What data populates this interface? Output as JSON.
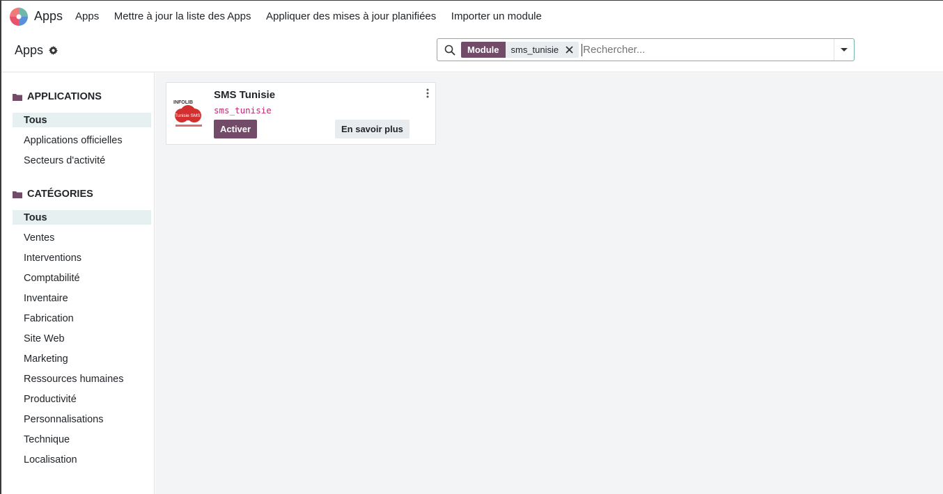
{
  "navbar": {
    "brand": "Apps",
    "menu": [
      "Apps",
      "Mettre à jour la liste des Apps",
      "Appliquer des mises à jour planifiées",
      "Importer un module"
    ]
  },
  "control_panel": {
    "breadcrumb": "Apps",
    "search": {
      "facet_label": "Module",
      "facet_value": "sms_tunisie",
      "placeholder": "Rechercher..."
    }
  },
  "sidebar": {
    "applications_header": "APPLICATIONS",
    "applications": [
      "Tous",
      "Applications officielles",
      "Secteurs d'activité"
    ],
    "categories_header": "CATÉGORIES",
    "categories": [
      "Tous",
      "Ventes",
      "Interventions",
      "Comptabilité",
      "Inventaire",
      "Fabrication",
      "Site Web",
      "Marketing",
      "Ressources humaines",
      "Productivité",
      "Personnalisations",
      "Technique",
      "Localisation"
    ]
  },
  "module_card": {
    "title": "SMS Tunisie",
    "technical_name": "sms_tunisie",
    "activate_label": "Activer",
    "learn_more_label": "En savoir plus",
    "logo_text_top": "INFOLIB",
    "logo_text_badge": "Tunisie SMS"
  },
  "colors": {
    "primary": "#714b67",
    "accent": "#71b5ad",
    "active_bg": "#e6f0f0",
    "tech_name": "#c0286f"
  }
}
